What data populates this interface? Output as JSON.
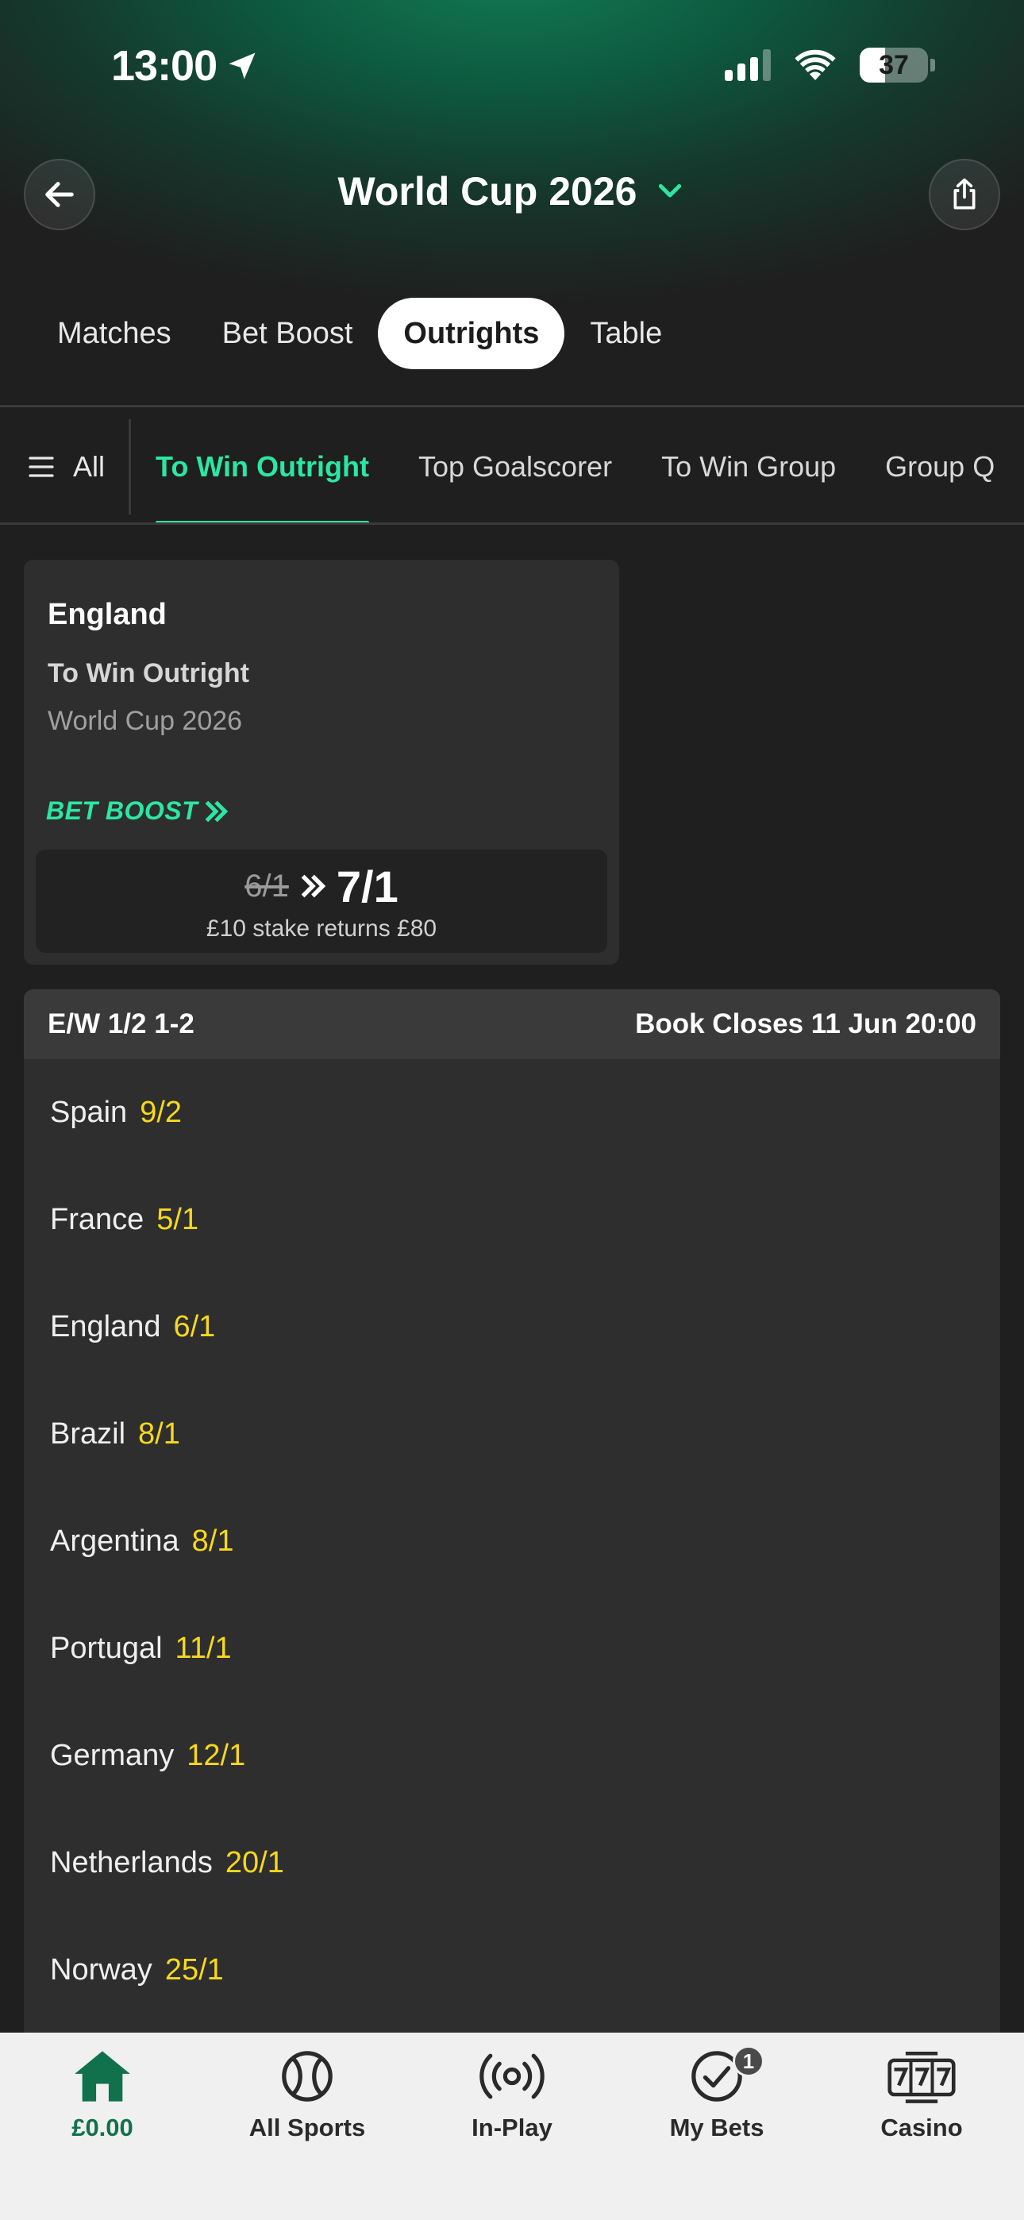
{
  "status_bar": {
    "time": "13:00",
    "battery": "37"
  },
  "header": {
    "title": "World Cup 2026"
  },
  "pill_tabs": [
    {
      "label": "Matches",
      "active": false
    },
    {
      "label": "Bet Boost",
      "active": false
    },
    {
      "label": "Outrights",
      "active": true
    },
    {
      "label": "Table",
      "active": false
    }
  ],
  "market_tabs": {
    "all_label": "All",
    "items": [
      {
        "label": "To Win Outright",
        "active": true
      },
      {
        "label": "Top Goalscorer",
        "active": false
      },
      {
        "label": "To Win Group",
        "active": false
      },
      {
        "label": "Group Q",
        "active": false
      }
    ]
  },
  "boost_card": {
    "team": "England",
    "market": "To Win Outright",
    "competition": "World Cup 2026",
    "boost_label": "BET BOOST",
    "old_odds": "6/1",
    "new_odds": "7/1",
    "returns": "£10 stake returns £80"
  },
  "market": {
    "each_way": "E/W 1/2 1-2",
    "book_closes": "Book Closes 11 Jun 20:00",
    "selections": [
      {
        "name": "Spain",
        "price": "9/2"
      },
      {
        "name": "France",
        "price": "5/1"
      },
      {
        "name": "England",
        "price": "6/1"
      },
      {
        "name": "Brazil",
        "price": "8/1"
      },
      {
        "name": "Argentina",
        "price": "8/1"
      },
      {
        "name": "Portugal",
        "price": "11/1"
      },
      {
        "name": "Germany",
        "price": "12/1"
      },
      {
        "name": "Netherlands",
        "price": "20/1"
      },
      {
        "name": "Norway",
        "price": "25/1"
      }
    ]
  },
  "bottom_nav": [
    {
      "label": "£0.00",
      "icon": "home-icon"
    },
    {
      "label": "All Sports",
      "icon": "ball-icon"
    },
    {
      "label": "In-Play",
      "icon": "live-icon"
    },
    {
      "label": "My Bets",
      "icon": "check-circle-icon",
      "badge": "1"
    },
    {
      "label": "Casino",
      "icon": "slot-machine-icon"
    }
  ],
  "colors": {
    "accent_green": "#2ce6a3",
    "price_yellow": "#f8d81c",
    "brand_green": "#11714d"
  }
}
